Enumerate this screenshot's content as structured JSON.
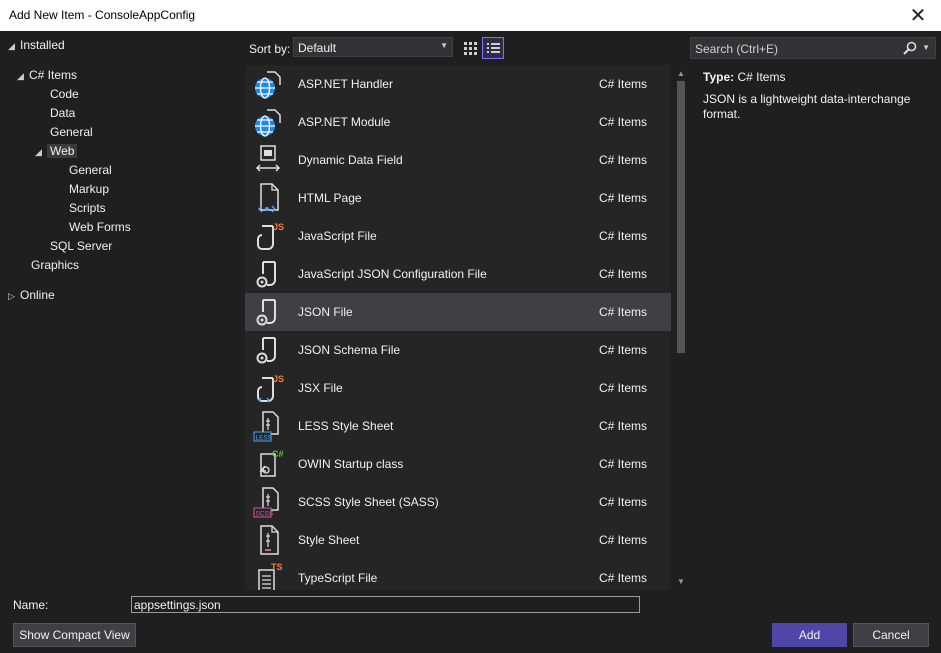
{
  "window": {
    "title": "Add New Item - ConsoleAppConfig",
    "close_glyph": "✕"
  },
  "tree": {
    "installed": "Installed",
    "csharp_items": "C# Items",
    "code": "Code",
    "data": "Data",
    "general": "General",
    "web": "Web",
    "web_general": "General",
    "markup": "Markup",
    "scripts": "Scripts",
    "web_forms": "Web Forms",
    "sql_server": "SQL Server",
    "graphics": "Graphics",
    "online": "Online"
  },
  "toolbar": {
    "sort_label": "Sort by:",
    "sort_value": "Default"
  },
  "search": {
    "placeholder": "Search (Ctrl+E)"
  },
  "items": [
    {
      "name": "ASP.NET Handler",
      "category": "C# Items",
      "icon": "globe-icon"
    },
    {
      "name": "ASP.NET Module",
      "category": "C# Items",
      "icon": "globe-icon"
    },
    {
      "name": "Dynamic Data Field",
      "category": "C# Items",
      "icon": "dynamic-data-icon"
    },
    {
      "name": "HTML Page",
      "category": "C# Items",
      "icon": "html-page-icon"
    },
    {
      "name": "JavaScript File",
      "category": "C# Items",
      "icon": "javascript-file-icon"
    },
    {
      "name": "JavaScript JSON Configuration File",
      "category": "C# Items",
      "icon": "json-config-icon"
    },
    {
      "name": "JSON File",
      "category": "C# Items",
      "icon": "json-file-icon"
    },
    {
      "name": "JSON Schema File",
      "category": "C# Items",
      "icon": "json-schema-icon"
    },
    {
      "name": "JSX File",
      "category": "C# Items",
      "icon": "jsx-file-icon"
    },
    {
      "name": "LESS Style Sheet",
      "category": "C# Items",
      "icon": "less-icon"
    },
    {
      "name": "OWIN Startup class",
      "category": "C# Items",
      "icon": "owin-icon"
    },
    {
      "name": "SCSS Style Sheet (SASS)",
      "category": "C# Items",
      "icon": "scss-icon"
    },
    {
      "name": "Style Sheet",
      "category": "C# Items",
      "icon": "style-sheet-icon"
    },
    {
      "name": "TypeScript File",
      "category": "C# Items",
      "icon": "typescript-file-icon"
    }
  ],
  "details": {
    "type_label": "Type:",
    "type_value": "C# Items",
    "description": "JSON is a lightweight data-interchange format."
  },
  "name_field": {
    "label": "Name:",
    "value": "appsettings.json"
  },
  "buttons": {
    "compact": "Show Compact View",
    "add": "Add",
    "cancel": "Cancel"
  },
  "colors": {
    "accent": "#4f46a8",
    "selection": "#3f3f46",
    "background": "#1f1f1f",
    "list_bg": "#252526"
  }
}
